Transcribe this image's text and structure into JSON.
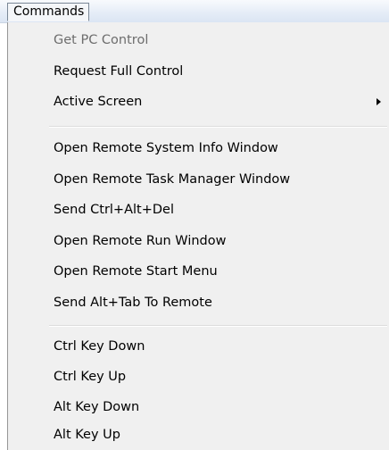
{
  "menubar": {
    "title": "Commands"
  },
  "menu": {
    "items": [
      {
        "label": "Get PC Control",
        "enabled": false
      },
      {
        "label": "Request Full Control",
        "enabled": true
      },
      {
        "label": "Active Screen",
        "enabled": true,
        "has_submenu": true,
        "submenu_icon": "chevron-right-icon"
      },
      {
        "label": "Open Remote System Info Window",
        "enabled": true
      },
      {
        "label": "Open Remote Task Manager Window",
        "enabled": true
      },
      {
        "label": "Send Ctrl+Alt+Del",
        "enabled": true
      },
      {
        "label": "Open Remote Run Window",
        "enabled": true
      },
      {
        "label": "Open Remote Start Menu",
        "enabled": true
      },
      {
        "label": "Send Alt+Tab To Remote",
        "enabled": true
      },
      {
        "label": "Ctrl Key Down",
        "enabled": true
      },
      {
        "label": "Ctrl Key Up",
        "enabled": true
      },
      {
        "label": "Alt Key Down",
        "enabled": true
      },
      {
        "label": "Alt Key Up",
        "enabled": true
      }
    ]
  },
  "colors": {
    "menu_background": "#f0f0f0",
    "disabled_text": "#6d6d6d",
    "menubar_gradient_top": "#f8fafd",
    "menubar_gradient_bottom": "#dbe5f3"
  }
}
